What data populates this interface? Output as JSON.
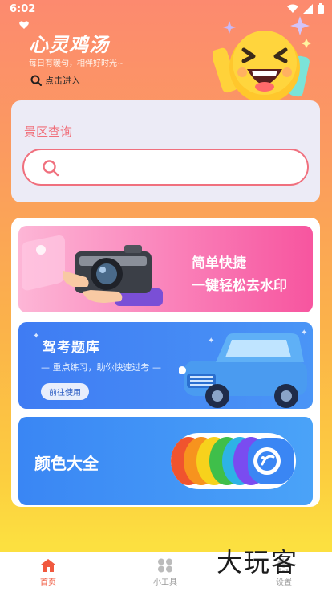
{
  "status_bar": {
    "time": "6:02"
  },
  "header": {
    "title": "心灵鸡汤",
    "subtitle": "每日有暖句，相伴好时光~",
    "enter_label": "点击进入"
  },
  "search": {
    "label": "景区查询",
    "placeholder": ""
  },
  "banners": {
    "watermark": {
      "line1": "简单快捷",
      "line2": "一键轻松去水印"
    },
    "exam": {
      "title": "驾考题库",
      "subtitle": "— 重点练习，助你快速过考 —",
      "button": "前往使用"
    },
    "color": {
      "title": "颜色大全"
    }
  },
  "tabbar": {
    "tabs": [
      {
        "label": "首页",
        "icon": "home-icon",
        "active": true
      },
      {
        "label": "小工具",
        "icon": "tools-icon",
        "active": false
      },
      {
        "label": "设置",
        "icon": "settings-icon",
        "active": false
      }
    ]
  },
  "watermark_text": "大玩客",
  "colors": {
    "accent": "#f0593f",
    "search_border": "#f0707e",
    "rainbow": [
      "#f0542e",
      "#f7931e",
      "#f7d21c",
      "#3fbf4a",
      "#2db3e6",
      "#7a4cf0",
      "#3a86f4"
    ]
  }
}
